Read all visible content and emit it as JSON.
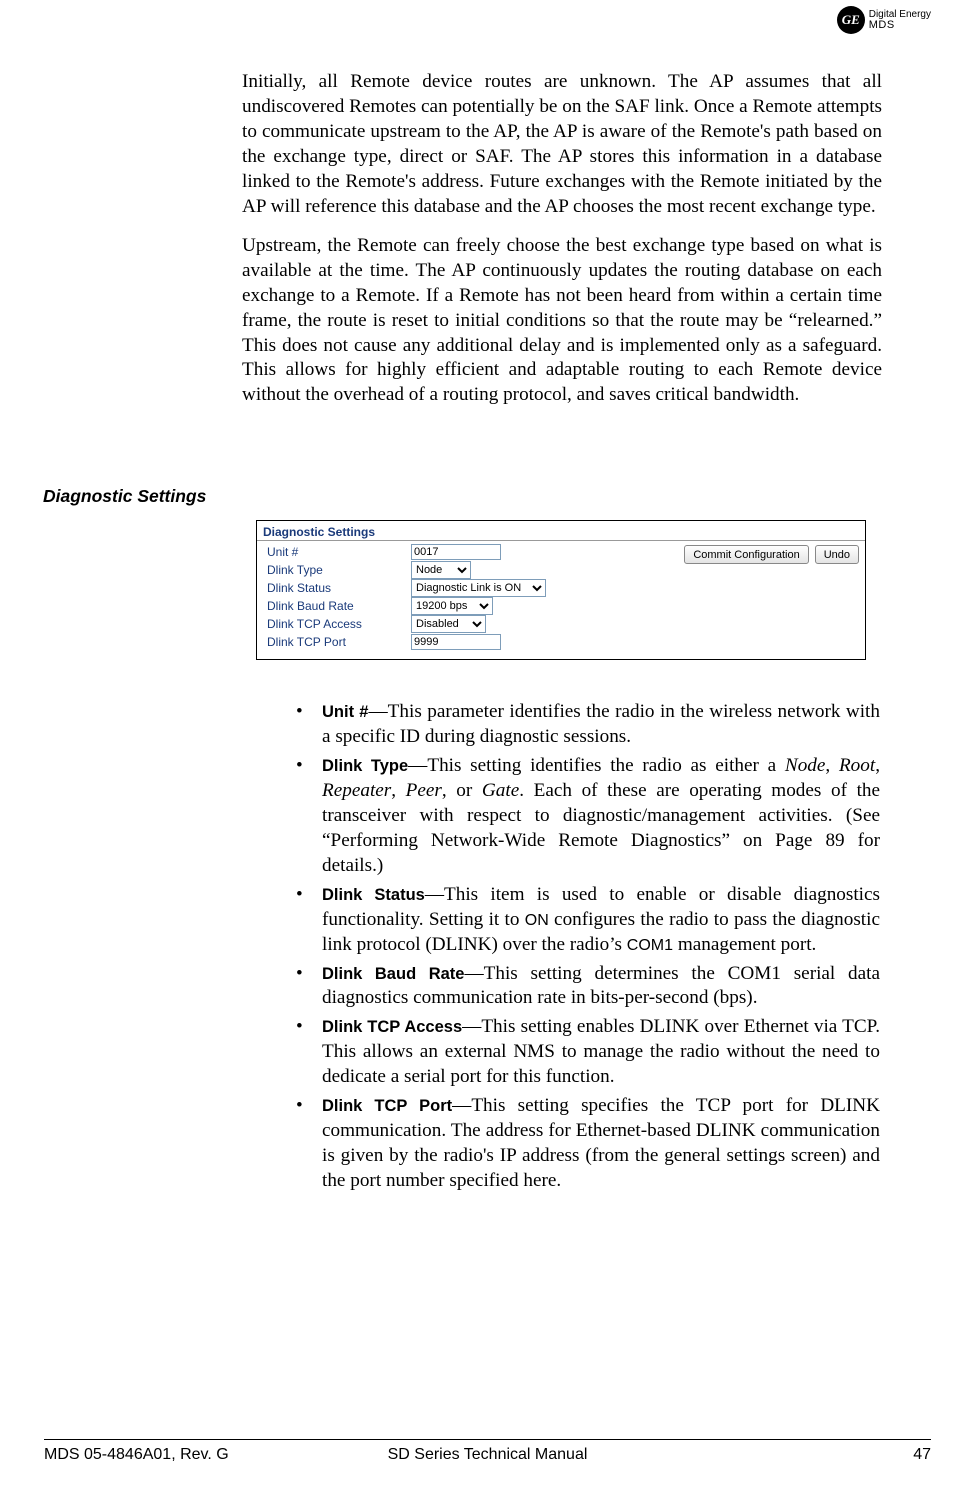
{
  "header": {
    "logo_monogram": "GE",
    "logo_line1": "Digital Energy",
    "logo_line2": "MDS"
  },
  "body": {
    "p1": "Initially, all Remote device routes are unknown. The AP assumes that all undiscovered Remotes can potentially be on the SAF link. Once a Remote attempts to communicate upstream to the AP, the AP is aware of the Remote's path based on the exchange type, direct or SAF. The AP stores this information in a database linked to the Remote's address. Future exchanges with the Remote initiated by the AP will reference this database and the AP chooses the most recent exchange type.",
    "p2": "Upstream, the Remote can freely choose the best exchange type based on what is available at the time. The AP continuously updates the routing database on each exchange to a Remote. If a Remote has not been heard from within a certain time frame, the route is reset to initial conditions so that the route may be “relearned.” This does not cause any additional delay and is implemented only as a safeguard. This allows for highly efficient and adaptable routing to each Remote device without the overhead of a routing protocol, and saves critical bandwidth."
  },
  "section_heading": "Diagnostic Settings",
  "panel": {
    "title": "Diagnostic Settings",
    "rows": {
      "unit_label": "Unit #",
      "unit_value": "0017",
      "dlink_type_label": "Dlink Type",
      "dlink_type_value": "Node",
      "dlink_status_label": "Dlink Status",
      "dlink_status_value": "Diagnostic Link is ON",
      "dlink_baud_label": "Dlink Baud Rate",
      "dlink_baud_value": "19200 bps",
      "dlink_tcp_access_label": "Dlink TCP Access",
      "dlink_tcp_access_value": "Disabled",
      "dlink_tcp_port_label": "Dlink TCP Port",
      "dlink_tcp_port_value": "9999"
    },
    "buttons": {
      "commit": "Commit Configuration",
      "undo": "Undo"
    }
  },
  "bullets": {
    "b1_term": "Unit #",
    "b1_text": "—This parameter identifies the radio in the wireless network with a specific ID during diagnostic sessions.",
    "b2_term": "Dlink Type",
    "b2_text_a": "—This setting identifies the radio as either a ",
    "b2_i1": "Node",
    "b2_sep1": ", ",
    "b2_i2": "Root",
    "b2_sep2": ", ",
    "b2_i3": "Repeater",
    "b2_sep3": ", ",
    "b2_i4": "Peer",
    "b2_sep4": ", or ",
    "b2_i5": "Gate",
    "b2_text_b": ". Each of these are operating modes of the transceiver with respect to diagnostic/management activities. (See “Performing Network-Wide Remote Diagnostics” on Page 89 for details.)",
    "b3_term": "Dlink Status",
    "b3_text_a": "—This item is used to enable or disable diagnostics functionality. Setting it to ",
    "b3_on": "ON",
    "b3_text_b": " configures the radio to pass the diagnostic link protocol (DLINK) over the radio’s ",
    "b3_com1": "COM1",
    "b3_text_c": " management port.",
    "b4_term": "Dlink Baud Rate",
    "b4_text": "—This setting determines the COM1 serial data diagnostics communication rate in bits-per-second (bps).",
    "b5_term": "Dlink TCP Access",
    "b5_text": "—This setting enables DLINK over Ethernet via TCP. This allows an external NMS to manage the radio without the need to dedicate a serial port for this function.",
    "b6_term": "Dlink TCP Port",
    "b6_text": "—This setting specifies the TCP port for DLINK communication. The address for Ethernet-based DLINK communication is given by the radio's IP address (from the general settings screen) and the port number specified here."
  },
  "footer": {
    "left": "MDS 05-4846A01, Rev. G",
    "center": "SD Series Technical Manual",
    "right": "47"
  }
}
